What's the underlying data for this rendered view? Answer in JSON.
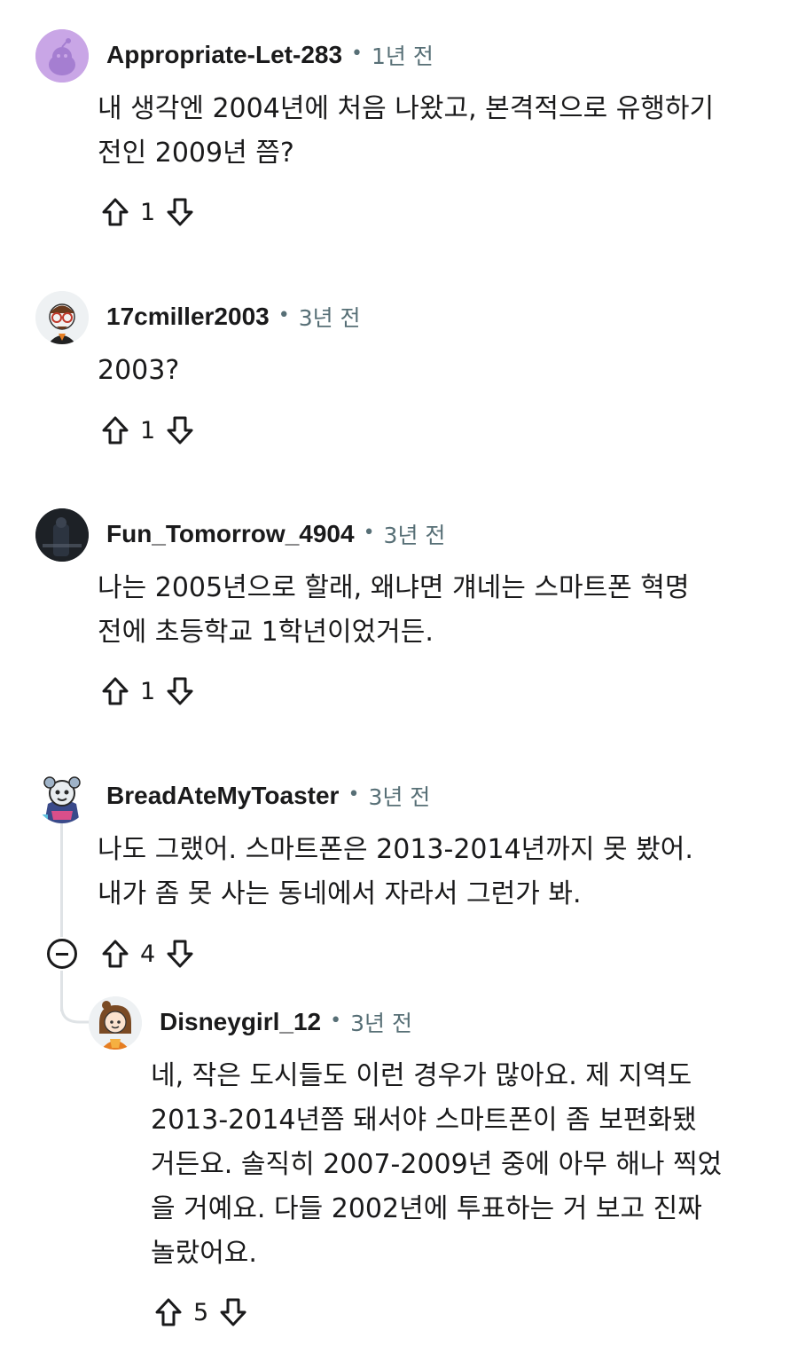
{
  "comments": [
    {
      "username": "Appropriate-Let-283",
      "time": "1년 전",
      "body": [
        "내 생각엔 2004년에 처음 나왔고, 본격적으로 유행하기",
        "전인 2009년 쯤?"
      ],
      "score": "1",
      "avatar_icon": "snoo-default-avatar-icon",
      "avatar_color": "#c9a6e6"
    },
    {
      "username": "17cmiller2003",
      "time": "3년 전",
      "body": [
        "2003?"
      ],
      "score": "1",
      "avatar_icon": "snoo-glasses-avatar-icon"
    },
    {
      "username": "Fun_Tomorrow_4904",
      "time": "3년 전",
      "body": [
        "나는 2005년으로 할래, 왜냐면 걔네는 스마트폰 혁명",
        "전에 초등학교 1학년이었거든."
      ],
      "score": "1",
      "avatar_icon": "dark-photo-avatar-icon"
    },
    {
      "username": "BreadAteMyToaster",
      "time": "3년 전",
      "body": [
        "나도 그랬어. 스마트폰은 2013-2014년까지 못 봤어.",
        "내가 좀 못 사는 동네에서 자라서 그런가 봐."
      ],
      "score": "4",
      "avatar_icon": "snoo-hoodie-avatar-icon"
    },
    {
      "username": "Disneygirl_12",
      "time": "3년 전",
      "body": [
        "네, 작은 도시들도 이런 경우가 많아요. 제 지역도",
        "2013-2014년쯤 돼서야 스마트폰이 좀 보편화됐",
        "거든요. 솔직히 2007-2009년 중에 아무 해나 찍었",
        "을 거예요. 다들 2002년에 투표하는 거 보고 진짜",
        "놀랐어요."
      ],
      "score": "5",
      "avatar_icon": "snoo-girl-avatar-icon"
    }
  ],
  "separator": "•",
  "colors": {
    "meta": "#576f76",
    "text": "#1a1a1b",
    "thread": "#dfe3e6"
  }
}
